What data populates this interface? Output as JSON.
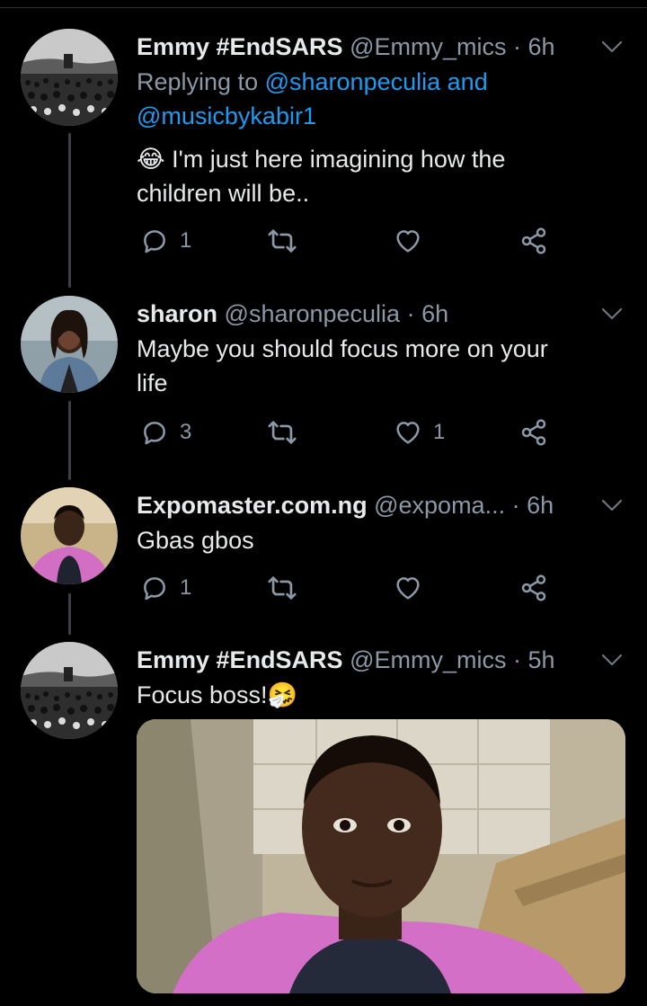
{
  "tweets": [
    {
      "name": "Emmy #EndSARS",
      "handle": "@Emmy_mics",
      "dot": "·",
      "time": "6h",
      "replying_prefix": "Replying to",
      "replying_user1": "@sharonpeculia",
      "replying_and": "and",
      "replying_user2": "@musicbykabir1",
      "emoji": "😂",
      "text_line1": "I'm just here imagining how the",
      "text_line2": "children will be..",
      "replies": "1",
      "retweets": "",
      "likes": ""
    },
    {
      "name": "sharon",
      "handle": "@sharonpeculia",
      "dot": "·",
      "time": "6h",
      "text_line1": "Maybe you should focus more on your",
      "text_line2": "life",
      "replies": "3",
      "retweets": "",
      "likes": "1"
    },
    {
      "name": "Expomaster.com.ng",
      "handle": "@expoma...",
      "dot": "·",
      "time": "6h",
      "text_line1": "Gbas gbos",
      "replies": "1",
      "retweets": "",
      "likes": ""
    },
    {
      "name": "Emmy #EndSARS",
      "handle": "@Emmy_mics",
      "dot": "·",
      "time": "5h",
      "text_line1": "Focus boss!",
      "emoji": "🤧"
    }
  ],
  "colors": {
    "background": "#000000",
    "text": "#e7e9ea",
    "secondary": "#8b98a5",
    "link": "#1d9bf0",
    "thread_line": "#3d4146"
  },
  "icons": {
    "reply": "reply-bubble-icon",
    "retweet": "retweet-icon",
    "like": "heart-icon",
    "share": "share-icon",
    "menu": "chevron-down-icon"
  }
}
